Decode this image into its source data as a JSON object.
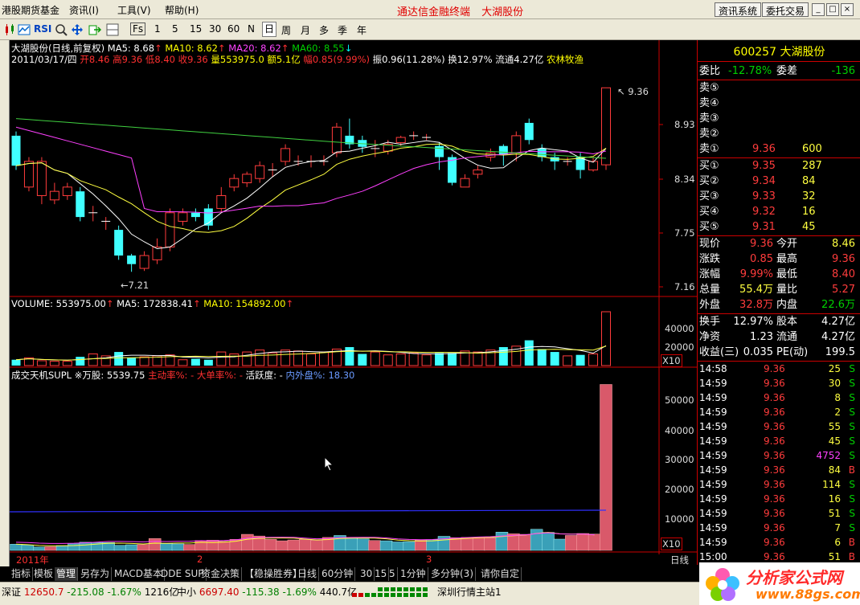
{
  "menubar": {
    "app_title": "港股期货基金",
    "menu": [
      "资讯(I)",
      "工具(V)",
      "帮助(H)"
    ],
    "center_title": "通达信金融终端",
    "stock_title": "大湖股份",
    "btn_news": "资讯系统",
    "btn_trade": "委托交易",
    "win_controls": [
      "_",
      "□",
      "×"
    ]
  },
  "toolbar": {
    "rsi": "RSI",
    "fs": "Fs",
    "periods": [
      "1",
      "5",
      "15",
      "30",
      "60",
      "N",
      "日",
      "周",
      "月",
      "多",
      "季",
      "年"
    ],
    "selected_period": "日"
  },
  "kline_header": {
    "line1_name": "大湖股份(日线,前复权)",
    "ma5": "MA5: 8.68",
    "ma10": "MA10: 8.62",
    "ma20": "MA20: 8.62",
    "ma60": "MA60: 8.55",
    "date": "2011/03/17/四",
    "open": "开8.46",
    "high": "高9.36",
    "low": "低8.40",
    "close": "收9.36",
    "volume": "量553975.0",
    "amount": "额5.1亿",
    "change": "幅0.85(9.99%)",
    "amplitude": "振0.96(11.28%)",
    "turnover": "换12.97%",
    "float": "流通4.27亿",
    "sector": "农林牧渔"
  },
  "price_axis": [
    "8.93",
    "8.34",
    "7.75",
    "7.16"
  ],
  "annotations": {
    "high_label": "9.36",
    "low_label": "7.21"
  },
  "volume_header": {
    "vol": "VOLUME: 553975.00",
    "ma5": "MA5: 172838.41",
    "ma10": "MA10: 154892.00"
  },
  "volume_axis": [
    "40000",
    "20000"
  ],
  "volume_unit": "X10",
  "supl_header": {
    "name": "成交天机SUPL",
    "wan": "※万股: 5539.75",
    "active": "主动率%: -",
    "big": "大单率%: -",
    "activity": "活跃度: -",
    "inner_outer": "内外盘%: 18.30"
  },
  "supl_axis": [
    "50000",
    "40000",
    "30000",
    "20000",
    "10000"
  ],
  "supl_unit": "X10",
  "date_axis": {
    "year": "2011年",
    "m2": "2",
    "m3": "3",
    "period": "日线"
  },
  "chart_data": {
    "type": "candlestick",
    "ylim": [
      7.1,
      9.4
    ],
    "candles": [
      {
        "o": 8.8,
        "c": 8.45,
        "h": 8.85,
        "l": 8.4
      },
      {
        "o": 8.2,
        "c": 8.5,
        "h": 8.55,
        "l": 8.15
      },
      {
        "o": 8.1,
        "c": 8.5,
        "h": 8.55,
        "l": 8.0
      },
      {
        "o": 8.05,
        "c": 8.15,
        "h": 8.25,
        "l": 8.0
      },
      {
        "o": 8.1,
        "c": 8.2,
        "h": 8.25,
        "l": 8.05
      },
      {
        "o": 8.15,
        "c": 7.85,
        "h": 8.2,
        "l": 7.8
      },
      {
        "o": 7.9,
        "c": 7.9,
        "h": 7.98,
        "l": 7.8
      },
      {
        "o": 7.8,
        "c": 7.8,
        "h": 7.85,
        "l": 7.7
      },
      {
        "o": 7.7,
        "c": 7.4,
        "h": 7.75,
        "l": 7.35
      },
      {
        "o": 7.4,
        "c": 7.3,
        "h": 7.42,
        "l": 7.21
      },
      {
        "o": 7.25,
        "c": 7.4,
        "h": 7.45,
        "l": 7.22
      },
      {
        "o": 7.35,
        "c": 7.5,
        "h": 7.6,
        "l": 7.3
      },
      {
        "o": 7.5,
        "c": 7.9,
        "h": 7.95,
        "l": 7.45
      },
      {
        "o": 7.8,
        "c": 7.9,
        "h": 7.95,
        "l": 7.75
      },
      {
        "o": 7.9,
        "c": 7.85,
        "h": 7.95,
        "l": 7.8
      },
      {
        "o": 7.95,
        "c": 7.75,
        "h": 8.0,
        "l": 7.7
      },
      {
        "o": 7.95,
        "c": 8.1,
        "h": 8.2,
        "l": 7.9
      },
      {
        "o": 8.2,
        "c": 8.3,
        "h": 8.35,
        "l": 8.15
      },
      {
        "o": 8.25,
        "c": 8.35,
        "h": 8.38,
        "l": 8.2
      },
      {
        "o": 8.3,
        "c": 8.45,
        "h": 8.5,
        "l": 8.25
      },
      {
        "o": 8.4,
        "c": 8.4,
        "h": 8.48,
        "l": 8.32
      },
      {
        "o": 8.5,
        "c": 8.65,
        "h": 8.7,
        "l": 8.45
      },
      {
        "o": 8.5,
        "c": 8.5,
        "h": 8.57,
        "l": 8.45
      },
      {
        "o": 8.5,
        "c": 8.5,
        "h": 8.57,
        "l": 8.43
      },
      {
        "o": 8.5,
        "c": 8.5,
        "h": 8.57,
        "l": 8.45
      },
      {
        "o": 8.6,
        "c": 8.9,
        "h": 8.95,
        "l": 8.55
      },
      {
        "o": 8.8,
        "c": 8.7,
        "h": 9.0,
        "l": 8.65
      },
      {
        "o": 8.75,
        "c": 8.67,
        "h": 8.8,
        "l": 8.6
      },
      {
        "o": 8.65,
        "c": 8.65,
        "h": 8.75,
        "l": 8.55
      },
      {
        "o": 8.62,
        "c": 8.7,
        "h": 8.75,
        "l": 8.58
      },
      {
        "o": 8.72,
        "c": 8.78,
        "h": 8.8,
        "l": 8.68
      },
      {
        "o": 8.8,
        "c": 8.8,
        "h": 8.85,
        "l": 8.75
      },
      {
        "o": 8.78,
        "c": 8.78,
        "h": 8.82,
        "l": 8.75
      },
      {
        "o": 8.68,
        "c": 8.55,
        "h": 8.72,
        "l": 8.4
      },
      {
        "o": 8.55,
        "c": 8.25,
        "h": 8.58,
        "l": 8.22
      },
      {
        "o": 8.2,
        "c": 8.3,
        "h": 8.35,
        "l": 8.2
      },
      {
        "o": 8.35,
        "c": 8.4,
        "h": 8.45,
        "l": 8.3
      },
      {
        "o": 8.55,
        "c": 8.6,
        "h": 8.65,
        "l": 8.5
      },
      {
        "o": 8.68,
        "c": 8.58,
        "h": 8.7,
        "l": 8.45
      },
      {
        "o": 8.6,
        "c": 8.8,
        "h": 8.85,
        "l": 8.5
      },
      {
        "o": 8.95,
        "c": 8.75,
        "h": 9.0,
        "l": 8.7
      },
      {
        "o": 8.65,
        "c": 8.55,
        "h": 8.7,
        "l": 8.5
      },
      {
        "o": 8.55,
        "c": 8.5,
        "h": 8.6,
        "l": 8.4
      },
      {
        "o": 8.5,
        "c": 8.5,
        "h": 8.55,
        "l": 8.45
      },
      {
        "o": 8.55,
        "c": 8.4,
        "h": 8.6,
        "l": 8.3
      },
      {
        "o": 8.4,
        "c": 8.5,
        "h": 8.55,
        "l": 8.38
      },
      {
        "o": 8.46,
        "c": 9.36,
        "h": 9.36,
        "l": 8.4
      }
    ],
    "volume": [
      60,
      80,
      50,
      45,
      45,
      90,
      120,
      100,
      140,
      80,
      90,
      100,
      110,
      60,
      70,
      60,
      140,
      120,
      140,
      160,
      130,
      160,
      150,
      120,
      140,
      170,
      190,
      120,
      140,
      110,
      120,
      130,
      110,
      130,
      130,
      150,
      140,
      160,
      190,
      200,
      260,
      170,
      140,
      100,
      110,
      120,
      554
    ],
    "supl": [
      2200,
      1900,
      1200,
      1300,
      1700,
      2500,
      2900,
      2800,
      2800,
      1800,
      2000,
      2100,
      4200,
      2400,
      2300,
      2100,
      3500,
      3600,
      3200,
      3900,
      5700,
      5100,
      3900,
      3400,
      3700,
      3900,
      3600,
      4600,
      5300,
      4300,
      4100,
      3500,
      3400,
      3000,
      3100,
      3600,
      3800,
      5000,
      4500,
      4600,
      4600,
      4500,
      6500,
      5900,
      5700,
      7500,
      6400,
      4000,
      5300,
      6000,
      5800,
      59000
    ],
    "supl_colors": [
      "b",
      "b",
      "b",
      "r",
      "b",
      "b",
      "b",
      "b",
      "b",
      "b",
      "b",
      "r",
      "r",
      "b",
      "b",
      "r",
      "r",
      "r",
      "r",
      "r",
      "r",
      "r",
      "r",
      "r",
      "r",
      "r",
      "r",
      "r",
      "b",
      "b",
      "b",
      "r",
      "b",
      "b",
      "b",
      "r",
      "b",
      "b",
      "r",
      "r",
      "r",
      "r",
      "b",
      "r",
      "r",
      "b",
      "b",
      "b",
      "r",
      "r",
      "r",
      "r"
    ]
  },
  "right_panel": {
    "code": "600257",
    "name": "大湖股份",
    "weibi_label": "委比",
    "weibi_val": "-12.78%",
    "weicha_label": "委差",
    "weicha_val": "-136",
    "sell": [
      {
        "label": "卖⑤",
        "price": "",
        "vol": ""
      },
      {
        "label": "卖④",
        "price": "",
        "vol": ""
      },
      {
        "label": "卖③",
        "price": "",
        "vol": ""
      },
      {
        "label": "卖②",
        "price": "",
        "vol": ""
      },
      {
        "label": "卖①",
        "price": "9.36",
        "vol": "600"
      }
    ],
    "buy": [
      {
        "label": "买①",
        "price": "9.35",
        "vol": "287"
      },
      {
        "label": "买②",
        "price": "9.34",
        "vol": "84"
      },
      {
        "label": "买③",
        "price": "9.33",
        "vol": "32"
      },
      {
        "label": "买④",
        "price": "9.32",
        "vol": "16"
      },
      {
        "label": "买⑤",
        "price": "9.31",
        "vol": "45"
      }
    ],
    "quote": [
      {
        "l1": "现价",
        "v1": "9.36",
        "l2": "今开",
        "v2": "8.46"
      },
      {
        "l1": "涨跌",
        "v1": "0.85",
        "l2": "最高",
        "v2": "9.36"
      },
      {
        "l1": "涨幅",
        "v1": "9.99%",
        "l2": "最低",
        "v2": "8.40"
      },
      {
        "l1": "总量",
        "v1": "55.4万",
        "l2": "量比",
        "v2": "5.27"
      },
      {
        "l1": "外盘",
        "v1": "32.8万",
        "l2": "内盘",
        "v2": "22.6万"
      }
    ],
    "fund": [
      {
        "l1": "换手",
        "v1": "12.97%",
        "l2": "股本",
        "v2": "4.27亿"
      },
      {
        "l1": "净资",
        "v1": "1.23",
        "l2": "流通",
        "v2": "4.27亿"
      },
      {
        "l1": "收益(三)",
        "v1": "0.035",
        "l2": "PE(动)",
        "v2": "199.5"
      }
    ],
    "ticks": [
      {
        "t": "14:58",
        "p": "9.36",
        "v": "25",
        "s": "S"
      },
      {
        "t": "14:59",
        "p": "9.36",
        "v": "30",
        "s": "S"
      },
      {
        "t": "14:59",
        "p": "9.36",
        "v": "8",
        "s": "S"
      },
      {
        "t": "14:59",
        "p": "9.36",
        "v": "2",
        "s": "S"
      },
      {
        "t": "14:59",
        "p": "9.36",
        "v": "55",
        "s": "S"
      },
      {
        "t": "14:59",
        "p": "9.36",
        "v": "45",
        "s": "S"
      },
      {
        "t": "14:59",
        "p": "9.36",
        "v": "4752",
        "s": "S"
      },
      {
        "t": "14:59",
        "p": "9.36",
        "v": "84",
        "s": "B"
      },
      {
        "t": "14:59",
        "p": "9.36",
        "v": "114",
        "s": "S"
      },
      {
        "t": "14:59",
        "p": "9.36",
        "v": "16",
        "s": "S"
      },
      {
        "t": "14:59",
        "p": "9.36",
        "v": "51",
        "s": "S"
      },
      {
        "t": "14:59",
        "p": "9.36",
        "v": "7",
        "s": "S"
      },
      {
        "t": "14:59",
        "p": "9.36",
        "v": "6",
        "s": "B"
      },
      {
        "t": "15:00",
        "p": "9.36",
        "v": "51",
        "s": "B"
      }
    ]
  },
  "tabs": [
    "指标",
    "模板",
    "管理",
    "另存为",
    "MACD基本",
    "DDE SUP",
    "资金决策",
    "【稳操胜券】",
    "日线",
    "60分钟",
    "30",
    "15",
    "5",
    "1分钟",
    "多分钟(3)",
    "请你自定"
  ],
  "active_tab": "管理",
  "status": {
    "sz_label": "深证",
    "sz_val": "12650.7",
    "sz_chg": "-215.08",
    "sz_pct": "-1.67%",
    "sz_amt": "1216亿",
    "zx_label": "中小",
    "zx_val": "6697.40",
    "zx_chg": "-115.38",
    "zx_pct": "-1.69%",
    "zx_amt": "440.7亿",
    "station": "深圳行情主站1"
  },
  "logo": {
    "text": "分析家公式网",
    "url": "www.88gs.com"
  }
}
